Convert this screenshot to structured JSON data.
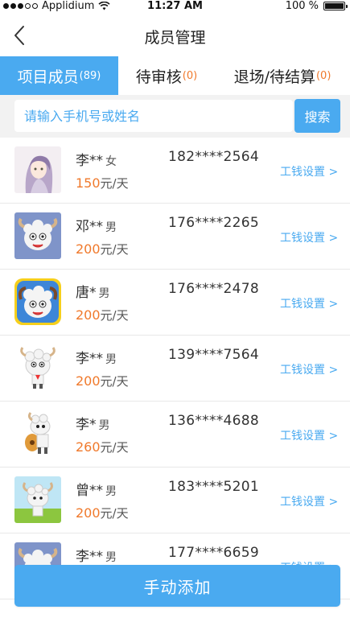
{
  "status_bar": {
    "carrier": "Applidium",
    "time": "11:27 AM",
    "battery": "100 %"
  },
  "nav": {
    "title": "成员管理",
    "back_icon": "chevron-left-icon"
  },
  "tabs": [
    {
      "label": "项目成员",
      "count": "(89)",
      "active": true
    },
    {
      "label": "待审核",
      "count": "(0)",
      "active": false
    },
    {
      "label": "退场/待结算",
      "count": "(0)",
      "active": false
    }
  ],
  "search": {
    "placeholder": "请输入手机号或姓名",
    "button_label": "搜索"
  },
  "members": [
    {
      "name": "李**",
      "gender": "女",
      "phone": "182****2564",
      "wage": "150",
      "unit": "元/天",
      "action": "工钱设置 >"
    },
    {
      "name": "邓**",
      "gender": "男",
      "phone": "176****2265",
      "wage": "200",
      "unit": "元/天",
      "action": "工钱设置 >"
    },
    {
      "name": "唐*",
      "gender": "男",
      "phone": "176****2478",
      "wage": "200",
      "unit": "元/天",
      "action": "工钱设置 >"
    },
    {
      "name": "李**",
      "gender": "男",
      "phone": "139****7564",
      "wage": "200",
      "unit": "元/天",
      "action": "工钱设置 >"
    },
    {
      "name": "李*",
      "gender": "男",
      "phone": "136****4688",
      "wage": "260",
      "unit": "元/天",
      "action": "工钱设置 >"
    },
    {
      "name": "曾**",
      "gender": "男",
      "phone": "183****5201",
      "wage": "200",
      "unit": "元/天",
      "action": "工钱设置 >"
    },
    {
      "name": "李**",
      "gender": "男",
      "phone": "177****6659",
      "wage": "",
      "unit": "",
      "action": "工钱设置 >"
    }
  ],
  "add_button": {
    "label": "手动添加"
  },
  "colors": {
    "accent": "#4aaaf0",
    "wage": "#f0792b"
  }
}
